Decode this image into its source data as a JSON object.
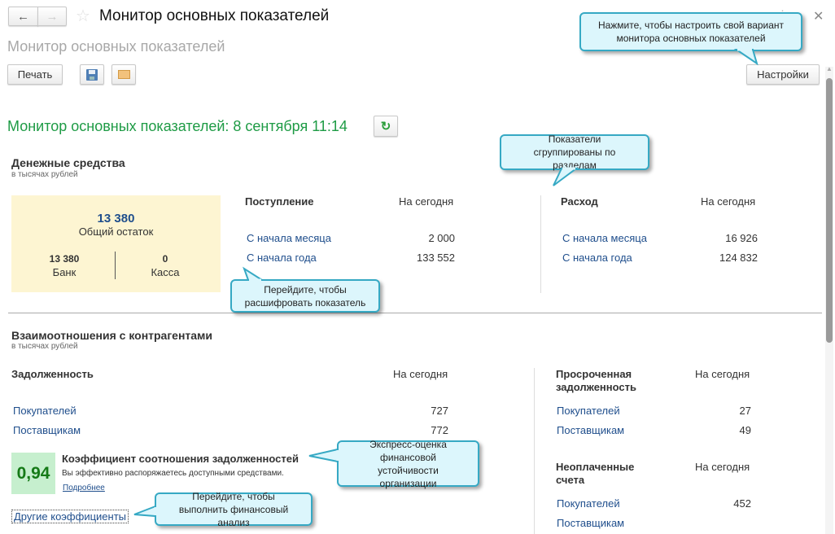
{
  "window": {
    "title": "Монитор основных показателей",
    "subtitle": "Монитор основных показателей"
  },
  "toolbar": {
    "print_label": "Печать",
    "settings_label": "Настройки"
  },
  "header": {
    "heading": "Монитор основных показателей: 8 сентября 11:14"
  },
  "cash": {
    "title": "Денежные средства",
    "units": "в тысячах рублей",
    "total_value": "13 380",
    "total_label": "Общий остаток",
    "bank_value": "13 380",
    "bank_label": "Банк",
    "cashdesk_value": "0",
    "cashdesk_label": "Касса",
    "income": {
      "title": "Поступление",
      "col": "На сегодня",
      "rows": [
        {
          "label": "С начала месяца",
          "value": "2 000"
        },
        {
          "label": "С начала года",
          "value": "133 552"
        }
      ]
    },
    "expense": {
      "title": "Расход",
      "col": "На сегодня",
      "rows": [
        {
          "label": "С начала месяца",
          "value": "16 926"
        },
        {
          "label": "С начала года",
          "value": "124 832"
        }
      ]
    }
  },
  "counterparties": {
    "title": "Взаимоотношения с контрагентами",
    "units": "в тысячах рублей",
    "debt": {
      "title": "Задолженность",
      "col": "На сегодня",
      "rows": [
        {
          "label": "Покупателей",
          "value": "727"
        },
        {
          "label": "Поставщикам",
          "value": "772"
        }
      ]
    },
    "overdue": {
      "title1": "Просроченная",
      "title2": "задолженность",
      "col": "На сегодня",
      "rows": [
        {
          "label": "Покупателей",
          "value": "27"
        },
        {
          "label": "Поставщикам",
          "value": "49"
        }
      ]
    },
    "unpaid": {
      "title1": "Неоплаченные",
      "title2": "счета",
      "col": "На сегодня",
      "rows": [
        {
          "label": "Покупателей",
          "value": "452"
        },
        {
          "label": "Поставщикам",
          "value": ""
        }
      ]
    },
    "ratio": {
      "value": "0,94",
      "title": "Коэффициент соотношения задолженностей",
      "text": "Вы эффективно распоряжаетесь доступными средствами.",
      "more": "Подробнее",
      "color": "#c6efce"
    },
    "other_ratios": "Другие коэффициенты"
  },
  "callouts": {
    "settings": "Нажмите, чтобы настроить свой вариант монитора основных показателей",
    "grouped": "Показатели сгруппированы по разделам",
    "drilldown": "Перейдите, чтобы расшифровать показатель",
    "express": "Экспресс-оценка финансовой устойчивости организации",
    "analysis": "Перейдите, чтобы выполнить финансовый анализ"
  },
  "colors": {
    "accent_green": "#1e9b45",
    "link": "#1f4e8c",
    "callout_bg": "#dcf6fc",
    "callout_border": "#36a9c4",
    "cash_box": "#fdf5d2"
  }
}
